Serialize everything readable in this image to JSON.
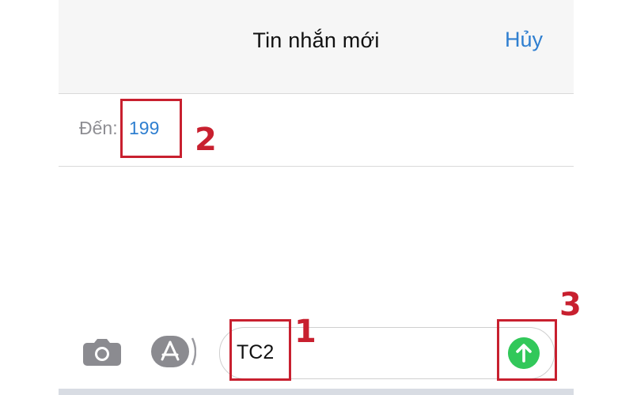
{
  "header": {
    "title": "Tin nhắn mới",
    "cancel_label": "Hủy"
  },
  "recipient": {
    "label": "Đến:",
    "value": "199"
  },
  "compose": {
    "message_value": "TC2"
  },
  "icons": {
    "camera": "camera-icon",
    "app_store": "app-store-icon",
    "send": "send-arrow-up-icon"
  },
  "colors": {
    "accent_blue": "#2f7fd0",
    "send_green": "#32c85a",
    "annotation_red": "#c8202f",
    "nav_background": "#f6f6f6"
  },
  "annotations": {
    "step1": "1",
    "step2": "2",
    "step3": "3"
  }
}
